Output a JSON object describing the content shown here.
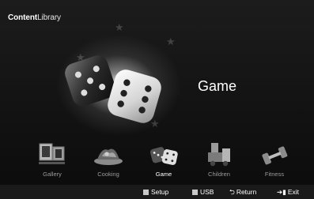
{
  "header": {
    "title_bold": "Content",
    "title_light": "Library"
  },
  "hero": {
    "title": "Game",
    "icon": "dice-icon"
  },
  "menu": {
    "items": [
      {
        "label": "Gallery",
        "icon": "gallery-icon"
      },
      {
        "label": "Cooking",
        "icon": "cooking-icon"
      },
      {
        "label": "Game",
        "icon": "dice-icon"
      },
      {
        "label": "Children",
        "icon": "children-icon"
      },
      {
        "label": "Fitness",
        "icon": "dumbbell-icon"
      }
    ],
    "selected": "Game"
  },
  "footer": {
    "setup": "Setup",
    "usb": "USB",
    "return": "Return",
    "exit": "Exit"
  },
  "colors": {
    "background": "#000000",
    "footer": "#1a1a1a",
    "inactive_label": "#9a9a9a"
  }
}
